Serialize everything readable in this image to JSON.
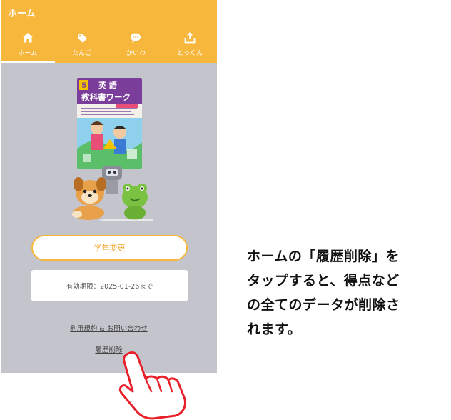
{
  "app": {
    "title": "ホーム"
  },
  "tabs": [
    {
      "label": "ホーム",
      "icon": "home-icon",
      "active": true
    },
    {
      "label": "たんご",
      "icon": "tag-icon",
      "active": false
    },
    {
      "label": "かいわ",
      "icon": "chat-bubble-icon",
      "active": false
    },
    {
      "label": "とっくん",
      "icon": "tray-upload-icon",
      "active": false
    }
  ],
  "book": {
    "grade": "5",
    "title_line1": "英 語",
    "title_line2": "教科書ワーク",
    "icon": "textbook-cover-image"
  },
  "mascot": {
    "icon": "mascot-characters-image"
  },
  "grade_button": {
    "label": "学年変更"
  },
  "expiry": {
    "text": "有効期限：2025-01-26まで"
  },
  "links": {
    "terms": "利用規約 & お問い合わせ",
    "delete_history": "履歴削除"
  },
  "pointer": {
    "icon": "pointing-hand-icon"
  },
  "caption": {
    "lines": [
      "ホームの「履歴削除」を",
      "タップすると、得点など",
      "の全てのデータが削除さ",
      "れます。"
    ]
  },
  "colors": {
    "header": "#f6b73c",
    "background": "#c4c5cc",
    "hand_outline": "#e8202a"
  }
}
